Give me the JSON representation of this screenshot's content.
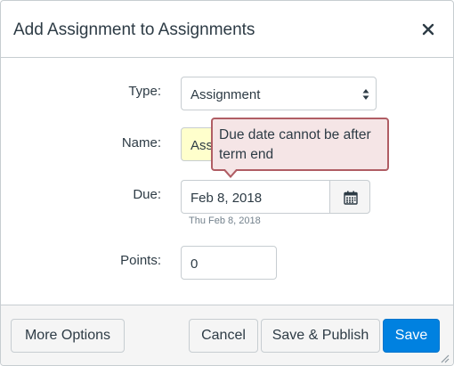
{
  "dialog": {
    "title": "Add Assignment to Assignments",
    "close_icon": "close-icon"
  },
  "form": {
    "type": {
      "label": "Type:",
      "value": "Assignment"
    },
    "name": {
      "label": "Name:",
      "value": "Assi"
    },
    "tooltip": {
      "text": "Due date cannot be after term end"
    },
    "due": {
      "label": "Due:",
      "value": "Feb 8, 2018",
      "hint": "Thu Feb 8, 2018",
      "calendar_icon": "calendar-icon"
    },
    "points": {
      "label": "Points:",
      "value": "0"
    }
  },
  "footer": {
    "more_options": "More Options",
    "cancel": "Cancel",
    "save_publish": "Save & Publish",
    "save": "Save"
  },
  "colors": {
    "primary": "#0081e0",
    "error_border": "#b05d64",
    "error_bg": "#f5e5e6",
    "highlight": "#ffffcc"
  }
}
